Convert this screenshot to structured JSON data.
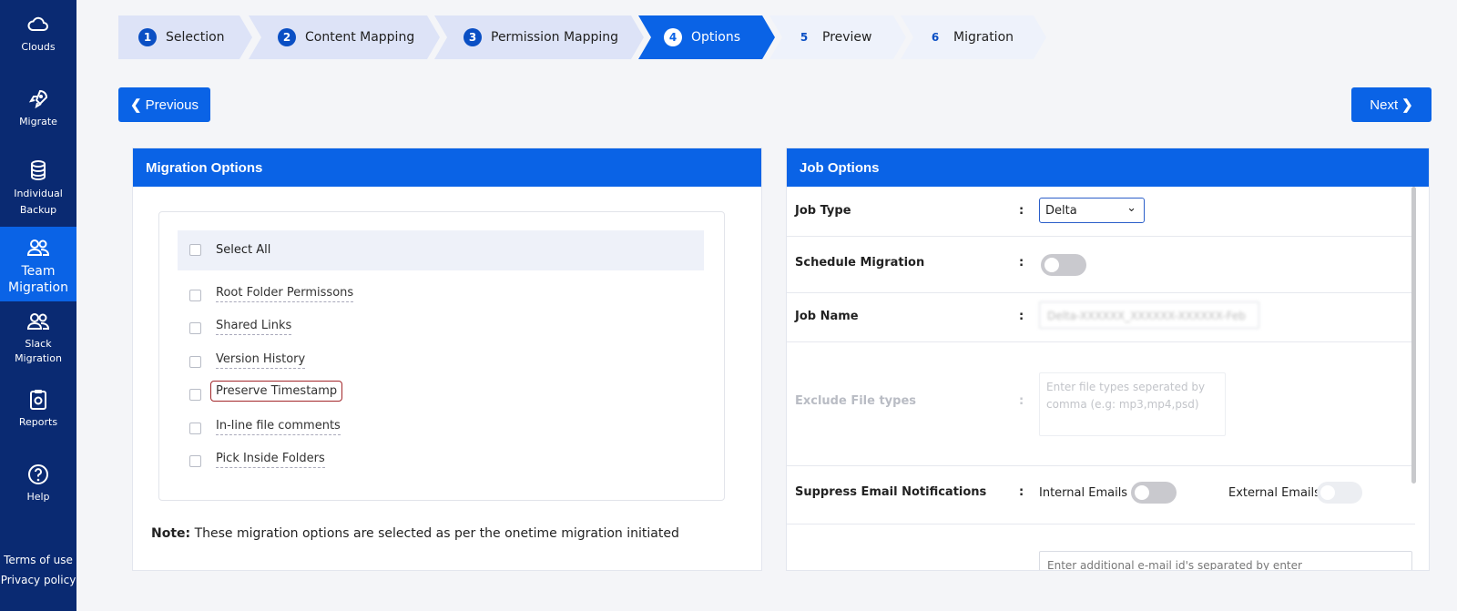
{
  "sidebar": {
    "items": [
      {
        "label": "Clouds",
        "icon": "cloud-icon"
      },
      {
        "label": "Migrate",
        "icon": "rocket-icon"
      },
      {
        "label": "Individual Backup",
        "icon": "database-icon"
      },
      {
        "label": "Team Migration",
        "icon": "users-icon"
      },
      {
        "label": "Slack Migration",
        "icon": "users-icon"
      },
      {
        "label": "Reports",
        "icon": "clipboard-icon"
      },
      {
        "label": "Help",
        "icon": "help-icon"
      }
    ],
    "links": {
      "terms": "Terms of use",
      "privacy": "Privacy policy"
    }
  },
  "stepper": {
    "steps": [
      {
        "num": "1",
        "label": "Selection"
      },
      {
        "num": "2",
        "label": "Content Mapping"
      },
      {
        "num": "3",
        "label": "Permission Mapping"
      },
      {
        "num": "4",
        "label": "Options"
      },
      {
        "num": "5",
        "label": "Preview"
      },
      {
        "num": "6",
        "label": "Migration"
      }
    ]
  },
  "nav": {
    "previous": "Previous",
    "next": "Next"
  },
  "migration_options": {
    "title": "Migration Options",
    "select_all": "Select All",
    "options": [
      "Root Folder Permissons",
      "Shared Links",
      "Version History",
      "Preserve Timestamp",
      "In-line file comments",
      "Pick Inside Folders"
    ],
    "note_bold": "Note:",
    "note_text": " These migration options are selected as per the onetime migration initiated"
  },
  "job_options": {
    "title": "Job Options",
    "colon": ":",
    "job_type_label": "Job Type",
    "job_type_value": "Delta",
    "schedule_label": "Schedule Migration",
    "job_name_label": "Job Name",
    "job_name_value": "Delta-XXXXXX_XXXXXX-XXXXXX-Feb",
    "exclude_label": "Exclude File types",
    "exclude_placeholder": "Enter file types seperated by comma (e.g: mp3,mp4,psd)",
    "suppress_label": "Suppress Email Notifications",
    "internal_emails": "Internal Emails",
    "external_emails": "External Emails",
    "additional_placeholder": "Enter additional e-mail id's separated by enter"
  },
  "colors": {
    "accent": "#0a63e6",
    "sidebar": "#0a2a72",
    "highlight": "#a2262a"
  }
}
